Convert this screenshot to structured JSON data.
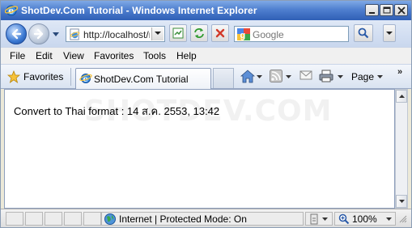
{
  "window": {
    "title": "ShotDev.Com Tutorial - Windows Internet Explorer"
  },
  "address_bar": {
    "url": "http://localhost/r"
  },
  "search": {
    "placeholder": "Google"
  },
  "menu": {
    "items": [
      "File",
      "Edit",
      "View",
      "Favorites",
      "Tools",
      "Help"
    ]
  },
  "favorites_bar": {
    "label": "Favorites",
    "active_tab": "ShotDev.Com Tutorial",
    "page_menu": "Page",
    "more": "»"
  },
  "page": {
    "watermark": "SHOTDEV.COM",
    "text": "Convert to Thai format : 14 ส.ค. 2553, 13:42"
  },
  "status_bar": {
    "zone": "Internet | Protected Mode: On",
    "zoom": "100%"
  },
  "icons": {
    "window_title": "ie-logo-icon",
    "back": "back-arrow-icon",
    "forward": "forward-arrow-icon",
    "address": "ie-page-icon",
    "compat": "compatibility-view-icon",
    "refresh": "refresh-icon",
    "stop": "stop-icon",
    "search_provider": "google-icon",
    "search": "magnifier-icon",
    "favorites": "star-icon",
    "home": "home-icon",
    "feeds": "rss-feed-icon",
    "mail": "mail-icon",
    "print": "printer-icon",
    "zone": "globe-icon",
    "zoom": "zoom-icon"
  },
  "colors": {
    "titlebar": "#2f5fb6",
    "accent": "#3a78d2",
    "stop_red": "#d23a2a"
  }
}
